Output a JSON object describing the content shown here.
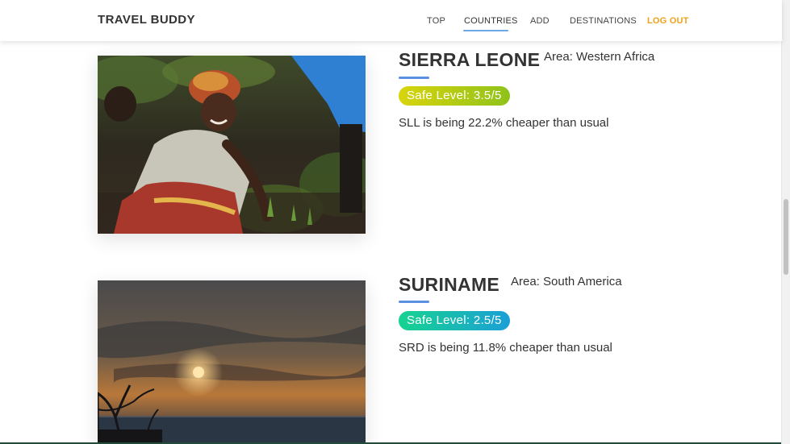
{
  "header": {
    "brand": "TRAVEL BUDDY",
    "nav": {
      "top": "TOP",
      "countries": "COUNTRIES",
      "add": "ADD",
      "destinations": "DESTINATIONS",
      "logout": "LOG OUT"
    },
    "active_tab": "COUNTRIES"
  },
  "colors": {
    "accent": "#5b8fe0",
    "logout": "#f0a11a",
    "badge_yellow_start": "#d9d40b",
    "badge_yellow_end": "#8fc21b",
    "badge_teal_start": "#16d390",
    "badge_teal_end": "#1b9fd7"
  },
  "countries": [
    {
      "name": "SIERRA LEONE",
      "area": "Area: Western Africa",
      "safe_level": "Safe Level: 3.5/5",
      "currency_note": "SLL is being 22.2% cheaper than usual",
      "photo": "woman-planting-photo"
    },
    {
      "name": "SURINAME",
      "area": "Area: South America",
      "safe_level": "Safe Level: 2.5/5",
      "currency_note": "SRD is being 11.8% cheaper than usual",
      "photo": "sunset-sea-photo"
    }
  ]
}
